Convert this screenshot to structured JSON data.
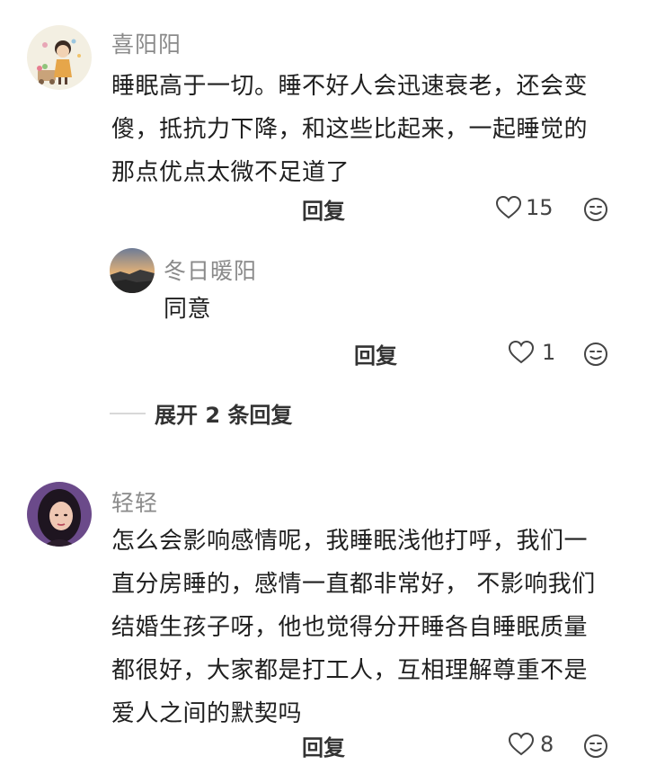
{
  "comments": [
    {
      "user": "喜阳阳",
      "lines": [
        "睡眠高于一切。睡不好人会迅速衰老，还会变",
        "傻，抵抗力下降，和这些比起来，一起睡觉的",
        "那点优点太微不足道了"
      ],
      "reply_label": "回复",
      "likes": "15",
      "avatar_icon": "cartoon-girl-avatar"
    },
    {
      "user": "轻轻",
      "lines": [
        "怎么会影响感情呢，我睡眠浅他打呼，我们一",
        "直分房睡的，感情一直都非常好， 不影响我们",
        "结婚生孩子呀，他也觉得分开睡各自睡眠质量",
        "都很好，大家都是打工人，互相理解尊重不是",
        "爱人之间的默契吗"
      ],
      "reply_label": "回复",
      "likes": "8",
      "avatar_icon": "woman-portrait-avatar"
    }
  ],
  "sub_reply": {
    "user": "冬日暖阳",
    "text": "同意",
    "reply_label": "回复",
    "likes": "1",
    "avatar_icon": "sunset-landscape-avatar"
  },
  "expand_label": "展开 2 条回复",
  "colors": {
    "name": "#8a8a8a",
    "text": "#1f1f1f",
    "action": "#333333"
  }
}
